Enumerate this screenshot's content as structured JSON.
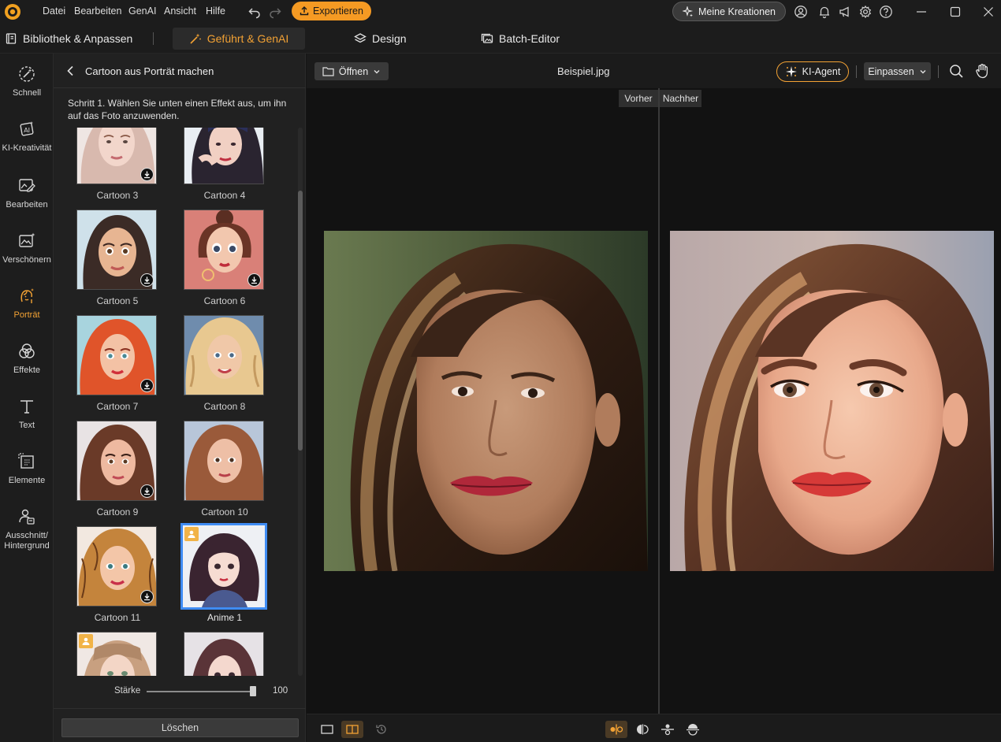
{
  "menu": {
    "items": [
      "Datei",
      "Bearbeiten",
      "GenAI",
      "Ansicht",
      "Hilfe"
    ],
    "export_label": "Exportieren",
    "my_creations_label": "Meine Kreationen"
  },
  "modes": {
    "library": "Bibliothek & Anpassen",
    "guided": "Geführt & GenAI",
    "design": "Design",
    "batch": "Batch-Editor"
  },
  "rail": [
    {
      "label": "Schnell",
      "icon": "magic-wand-icon"
    },
    {
      "label": "KI-Kreativität",
      "icon": "ai-creative-icon"
    },
    {
      "label": "Bearbeiten",
      "icon": "edit-image-icon"
    },
    {
      "label": "Verschönern",
      "icon": "beautify-icon"
    },
    {
      "label": "Porträt",
      "icon": "portrait-icon",
      "active": true
    },
    {
      "label": "Effekte",
      "icon": "effects-icon"
    },
    {
      "label": "Text",
      "icon": "text-icon"
    },
    {
      "label": "Elemente",
      "icon": "elements-icon"
    },
    {
      "label": "Ausschnitt/\nHintergrund",
      "icon": "cutout-icon"
    }
  ],
  "panel": {
    "title": "Cartoon aus Porträt machen",
    "step": "Schritt 1. Wählen Sie unten einen Effekt aus, um ihn auf das Foto anzuwenden.",
    "effects": [
      {
        "label": "Cartoon 3",
        "badge": "download"
      },
      {
        "label": "Cartoon 4",
        "badge": "none"
      },
      {
        "label": "Cartoon 5",
        "badge": "download"
      },
      {
        "label": "Cartoon 6",
        "badge": "download"
      },
      {
        "label": "Cartoon 7",
        "badge": "download"
      },
      {
        "label": "Cartoon 8",
        "badge": "none"
      },
      {
        "label": "Cartoon 9",
        "badge": "download"
      },
      {
        "label": "Cartoon 10",
        "badge": "none"
      },
      {
        "label": "Cartoon 11",
        "badge": "download"
      },
      {
        "label": "Anime 1",
        "badge": "pro",
        "selected": true
      },
      {
        "label": "",
        "badge": "pro"
      },
      {
        "label": "",
        "badge": "none"
      }
    ],
    "strength_label": "Stärke",
    "strength_value": "100",
    "clear_label": "Löschen"
  },
  "canvas": {
    "open_label": "Öffnen",
    "filename": "Beispiel.jpg",
    "agent_label": "KI-Agent",
    "fit_label": "Einpassen",
    "before_label": "Vorher",
    "after_label": "Nachher"
  },
  "colors": {
    "accent": "#f3a234",
    "export": "#f59a23",
    "selection": "#3f8cf3"
  }
}
